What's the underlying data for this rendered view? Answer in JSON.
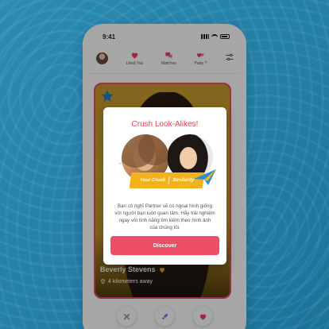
{
  "status_bar": {
    "time": "9:41"
  },
  "nav": {
    "items": [
      {
        "label": "Liked You",
        "icon": "heart-icon"
      },
      {
        "label": "Matches",
        "icon": "chat-bubbles-icon"
      },
      {
        "label": "Party ?",
        "icon": "hearts-icon"
      }
    ]
  },
  "card": {
    "name": "Beverly Stevens",
    "distance": "4 kilometers away"
  },
  "modal": {
    "title": "Crush Look-Alikes!",
    "banner_left": "Your Crush",
    "banner_right": "Similarity",
    "body": "Bạn có nghĩ Partner sẽ có ngoại hình giống với người bạn luôn quan tâm. Hãy trải nghiệm ngay với tính năng tìm kiếm theo hình ảnh của chúng tôi.",
    "button": "Discover"
  },
  "colors": {
    "accent": "#ec4e68",
    "title": "#e8425f",
    "banner": "#f2b21b",
    "background": "#1f7fa6"
  }
}
